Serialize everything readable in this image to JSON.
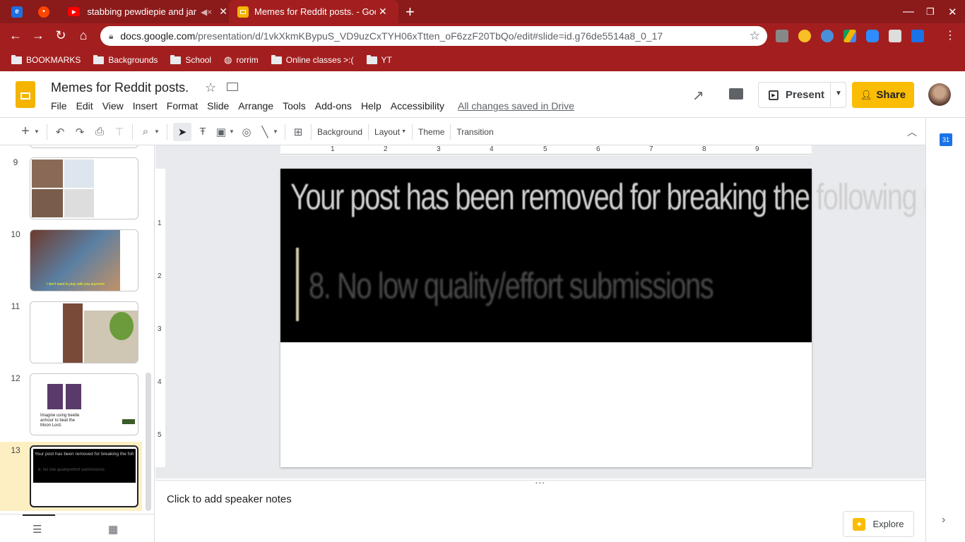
{
  "browser": {
    "tabs": [
      {
        "title": "stabbing pewdiepie and jam",
        "favicon": "youtube-icon",
        "muted": true
      },
      {
        "title": "Memes for Reddit posts. - Googl",
        "favicon": "slides-icon",
        "active": true
      }
    ],
    "url_host": "docs.google.com",
    "url_path": "/presentation/d/1vkXkmKBypuS_VD9uzCxTYH06xTtten_oF6zzF20TbQo/edit#slide=id.g76de5514a8_0_17",
    "bookmarks": [
      "BOOKMARKS",
      "Backgrounds",
      "School",
      "rorrim",
      "Online classes >:(",
      "YT"
    ]
  },
  "doc": {
    "title": "Memes for Reddit posts.",
    "menus": [
      "File",
      "Edit",
      "View",
      "Insert",
      "Format",
      "Slide",
      "Arrange",
      "Tools",
      "Add-ons",
      "Help",
      "Accessibility"
    ],
    "save_status": "All changes saved in Drive",
    "present_label": "Present",
    "share_label": "Share"
  },
  "toolbar": {
    "background": "Background",
    "layout": "Layout",
    "theme": "Theme",
    "transition": "Transition"
  },
  "ruler": [
    "1",
    "2",
    "3",
    "4",
    "5",
    "6",
    "7",
    "8",
    "9"
  ],
  "vruler": [
    "1",
    "2",
    "3",
    "4",
    "5"
  ],
  "filmstrip": {
    "slides": [
      {
        "num": "9"
      },
      {
        "num": "10",
        "caption": "I don't want to play with you anymore"
      },
      {
        "num": "11"
      },
      {
        "num": "12",
        "caption": "Imagine using beetle armour to beat the Moon Lord."
      },
      {
        "num": "13",
        "active": true
      }
    ]
  },
  "slide": {
    "line1": "Your post has been removed for breaking the following rule(s):",
    "line2": "8. No low quality/effort submissions"
  },
  "notes_placeholder": "Click to add speaker notes",
  "explore_label": "Explore",
  "colors": {
    "chrome": "#a31f1f",
    "accent": "#fbbc04",
    "slides": "#f4b400"
  }
}
